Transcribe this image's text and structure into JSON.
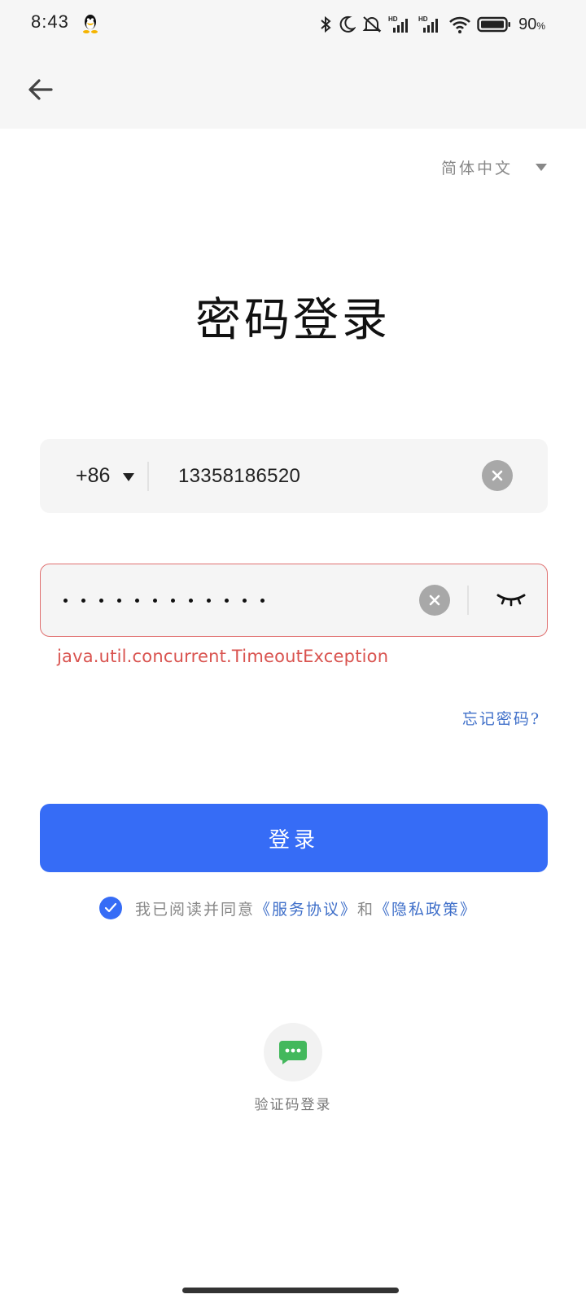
{
  "status_bar": {
    "time": "8:43",
    "battery_percent": "90",
    "battery_sign": "%",
    "icons": [
      "qq-icon",
      "bluetooth-icon",
      "do-not-disturb-icon",
      "mute-icon",
      "hd-signal-icon",
      "hd-signal-icon",
      "wifi-icon",
      "battery-icon"
    ]
  },
  "header": {
    "back_icon": "arrow-left-icon"
  },
  "language": {
    "label": "简体中文"
  },
  "title": "密码登录",
  "phone": {
    "country_code": "+86",
    "value": "13358186520"
  },
  "password": {
    "masked_length": 12,
    "visibility_icon": "eye-closed-icon"
  },
  "error_message": "java.util.concurrent.TimeoutException",
  "forgot_password": "忘记密码?",
  "login_button": "登录",
  "agreement": {
    "checked": true,
    "prefix": "我已阅读并同意",
    "service_link": "《服务协议》",
    "joiner": "和",
    "privacy_link": "《隐私政策》"
  },
  "alt_login": {
    "icon": "sms-icon",
    "label": "验证码登录"
  },
  "colors": {
    "primary": "#366cf6",
    "link": "#3f6fc9",
    "error": "#d9534f",
    "field_bg": "#f5f5f5"
  }
}
